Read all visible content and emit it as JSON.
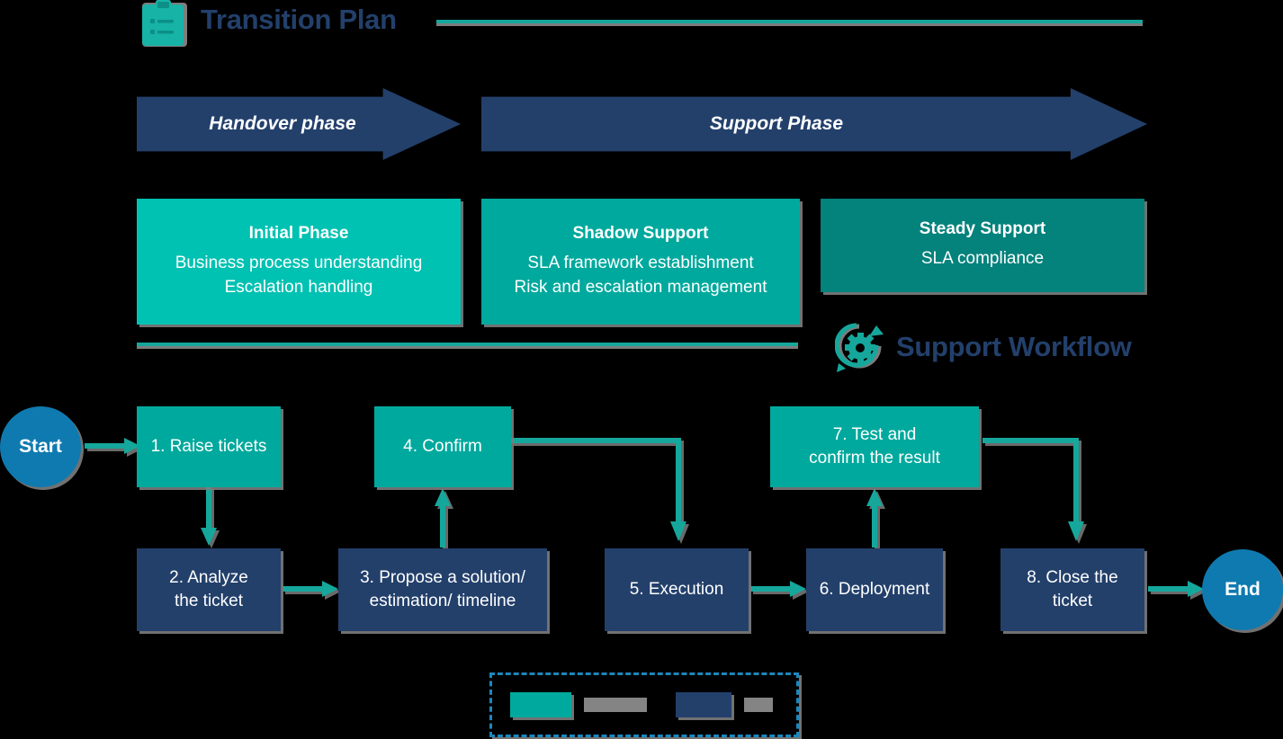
{
  "header": {
    "title": "Transition Plan",
    "icon": "clipboard-icon",
    "rule_color": "#16a79c"
  },
  "banners": [
    {
      "label": "Handover phase",
      "color": "#23406b"
    },
    {
      "label": "Support Phase",
      "color": "#23406b"
    }
  ],
  "phases": [
    {
      "title": "Initial Phase",
      "lines": [
        "Business process understanding",
        "Escalation handling"
      ],
      "color": "#00c2b2"
    },
    {
      "title": "Shadow Support",
      "lines": [
        "SLA framework establishment",
        "Risk and escalation management"
      ],
      "color": "#00a99d"
    },
    {
      "title": "Steady Support",
      "lines": [
        "SLA compliance"
      ],
      "color": "#04827c"
    }
  ],
  "workflow": {
    "title": "Support Workflow",
    "icon": "gear-refresh-icon",
    "start_label": "Start",
    "end_label": "End",
    "nodes": [
      {
        "label": "1. Raise tickets",
        "style": "teal"
      },
      {
        "label": "2. Analyze\nthe ticket",
        "style": "navy"
      },
      {
        "label": "3. Propose a solution/\nestimation/ timeline",
        "style": "navy"
      },
      {
        "label": "4. Confirm",
        "style": "teal"
      },
      {
        "label": "5. Execution",
        "style": "navy"
      },
      {
        "label": "6. Deployment",
        "style": "navy"
      },
      {
        "label": "7. Test and\nconfirm the result",
        "style": "teal"
      },
      {
        "label": "8. Close the\nticket",
        "style": "navy"
      }
    ]
  },
  "legend": {
    "border_color": "#1b87bd",
    "items": [
      {
        "swatch": "teal",
        "color": "#00a99d",
        "label": ""
      },
      {
        "swatch": "navy",
        "color": "#23406b",
        "label": ""
      }
    ]
  },
  "colors": {
    "teal": "#00a99d",
    "teal_light": "#00c2b2",
    "teal_dark": "#04827c",
    "navy": "#23406b",
    "blue": "#0f7ab0",
    "connector": "#16a79c",
    "shadow": "#7d7d7d",
    "redacted": "#848484",
    "background": "#000000"
  }
}
